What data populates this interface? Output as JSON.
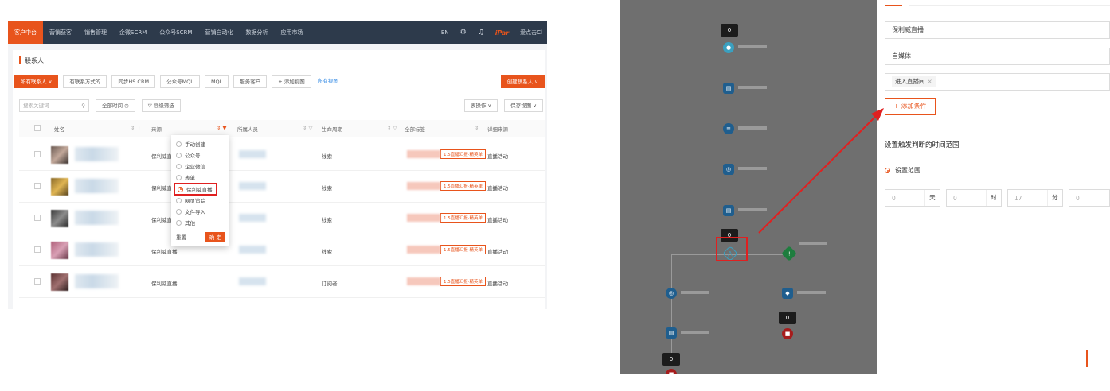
{
  "left": {
    "nav": {
      "items": [
        "客户中台",
        "营销获客",
        "销售管理",
        "企微SCRM",
        "公众号SCRM",
        "营销自动化",
        "数据分析",
        "应用市场"
      ],
      "lang": "EN",
      "brand": "iPar",
      "user": "爱点击Cl"
    },
    "page_title": "联系人",
    "filters": [
      "所有联系人 ∨",
      "有联系方式的",
      "同步HS CRM",
      "公众号MQL",
      "MQL",
      "服务客户",
      "+ 添加视图"
    ],
    "all_views_link": "所有视图",
    "create_button": "创建联系人 ∨",
    "search_placeholder": "搜索关键词",
    "time_filter": "全部时间 ◷",
    "advanced_filter": "▽ 高级筛选",
    "table_actions": "表操作 ∨",
    "save_view": "保存视图 ∨",
    "columns": [
      "姓名",
      "来源",
      "所属人员",
      "生命周期",
      "全部标签",
      "详细来源"
    ],
    "rows": [
      {
        "source": "保利威直播",
        "lifecycle": "线索",
        "tag": "1.5直播汇报·精英单",
        "detail": "直播活动"
      },
      {
        "source": "保利威直播",
        "lifecycle": "线索",
        "tag": "1.5直播汇报·精英单",
        "detail": "直播活动"
      },
      {
        "source": "保利威直播",
        "lifecycle": "线索",
        "tag": "1.5直播汇报·精英单",
        "detail": "直播活动"
      },
      {
        "source": "保利威直播",
        "lifecycle": "线索",
        "tag": "1.5直播汇报·精英单",
        "detail": "直播活动"
      },
      {
        "source": "保利威直播",
        "lifecycle": "订阅者",
        "tag": "1.5直播汇报·精英单",
        "detail": "直播活动"
      }
    ],
    "dropdown": {
      "options": [
        "手动创建",
        "公众号",
        "企业微信",
        "表单",
        "保利威直播",
        "网页追踪",
        "文件导入",
        "其他"
      ],
      "selected_index": 4,
      "reset": "重置",
      "confirm": "确 定"
    }
  },
  "right": {
    "flow": {
      "counts": [
        "0",
        "0",
        "0",
        "0",
        "0"
      ]
    },
    "form": {
      "field1": "保利威直播",
      "field2": "自媒体",
      "condition_tag": "进入直播间",
      "add_condition": "+ 添加条件",
      "section_title": "设置触发判断的时间范围",
      "range_option": "设置范围",
      "time": [
        {
          "value": "0",
          "unit": "天"
        },
        {
          "value": "0",
          "unit": "时"
        },
        {
          "value": "17",
          "unit": "分"
        },
        {
          "value": "0",
          "unit": ""
        }
      ]
    }
  },
  "colors": {
    "accent": "#e8541c",
    "highlight_red": "#e02020",
    "nav_bg": "#2d3a4b"
  }
}
